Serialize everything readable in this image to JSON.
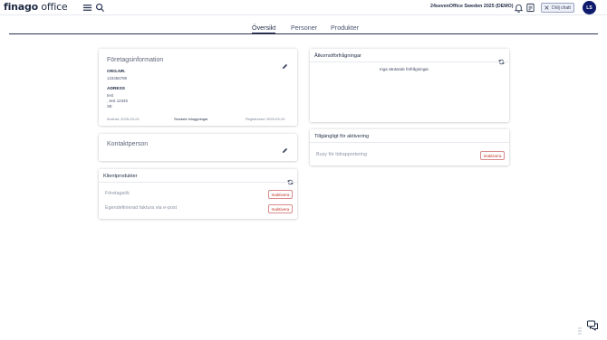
{
  "app": {
    "logo_brand": "finago",
    "logo_product": " office",
    "company": "24sevenOffice Sweden 2025 (DEMO)",
    "hide_chat_label": "Dölj chatt",
    "avatar_initials": "LS"
  },
  "tabs": [
    {
      "label": "Översikt",
      "active": true
    },
    {
      "label": "Personer",
      "active": false
    },
    {
      "label": "Produkter",
      "active": false
    }
  ],
  "company_info": {
    "title": "Företagsinformation",
    "orgnr_label": "ORG.NR.",
    "orgnr_value": "123456789",
    "address_label": "ADRESS",
    "address_lines": [
      "test",
      ", test 12345",
      "SE"
    ],
    "changed": "Ändrad: 2025-03-24",
    "recent_logins": "Senaste inloggningar",
    "registered": "Registrerad: 2025-03-24"
  },
  "contact": {
    "title": "Kontaktperson"
  },
  "client_products": {
    "title": "Klientprodukter",
    "items": [
      {
        "label": "Företagsök",
        "button": "Inaktivera"
      },
      {
        "label": "Egendefinierad faktura via e-post",
        "button": "Inaktivera"
      }
    ]
  },
  "access_requests": {
    "title": "Åtkomstförfrågningar",
    "empty": "Inga väntande förfrågningar."
  },
  "available": {
    "title": "Tillgängligt för aktivering",
    "items": [
      {
        "label": "Busy för tidrapportering",
        "button": "Inaktivera"
      }
    ]
  },
  "icons": {
    "menu": "hamburger-menu-icon",
    "search": "search-icon",
    "bell": "bell-icon",
    "notes": "notes-icon",
    "close": "close-icon",
    "edit": "pencil-icon",
    "refresh": "refresh-icon",
    "chat": "chat-icon",
    "drag": "drag-handle-icon"
  },
  "colors": {
    "primary": "#1f2b44",
    "avatar_bg": "#0e1a6b",
    "danger": "#c0392b"
  }
}
